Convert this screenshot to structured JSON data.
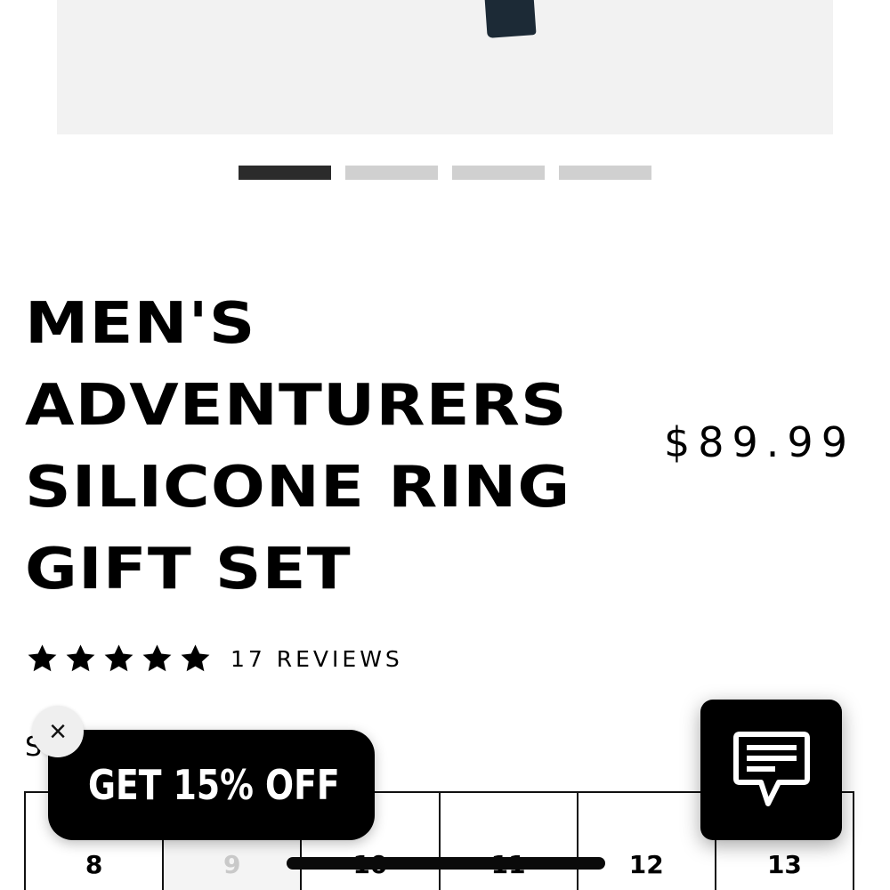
{
  "product": {
    "title_lines": [
      "MEN'S",
      "ADVENTURERS",
      "SILICONE RING",
      "GIFT SET"
    ],
    "price": "$89.99",
    "rating": {
      "stars": 5,
      "max": 5,
      "reviews_label": "17 REVIEWS"
    }
  },
  "gallery": {
    "slide_count": 4,
    "active_slide": 1
  },
  "size_selector": {
    "label_visible": "S",
    "sizes": [
      {
        "label": "8",
        "available": true
      },
      {
        "label": "9",
        "available": false
      },
      {
        "label": "10",
        "available": true
      },
      {
        "label": "11",
        "available": true
      },
      {
        "label": "12",
        "available": true
      },
      {
        "label": "13",
        "available": true
      }
    ]
  },
  "promo": {
    "label": "GET 15% OFF",
    "close_symbol": "×"
  },
  "chat": {
    "icon": "chat-bubble-icon"
  },
  "colors": {
    "accent": "#000000",
    "image_bg": "#f2f2f2",
    "dot_active": "#2b2b2b",
    "dot_inactive": "#d0d0d0"
  }
}
